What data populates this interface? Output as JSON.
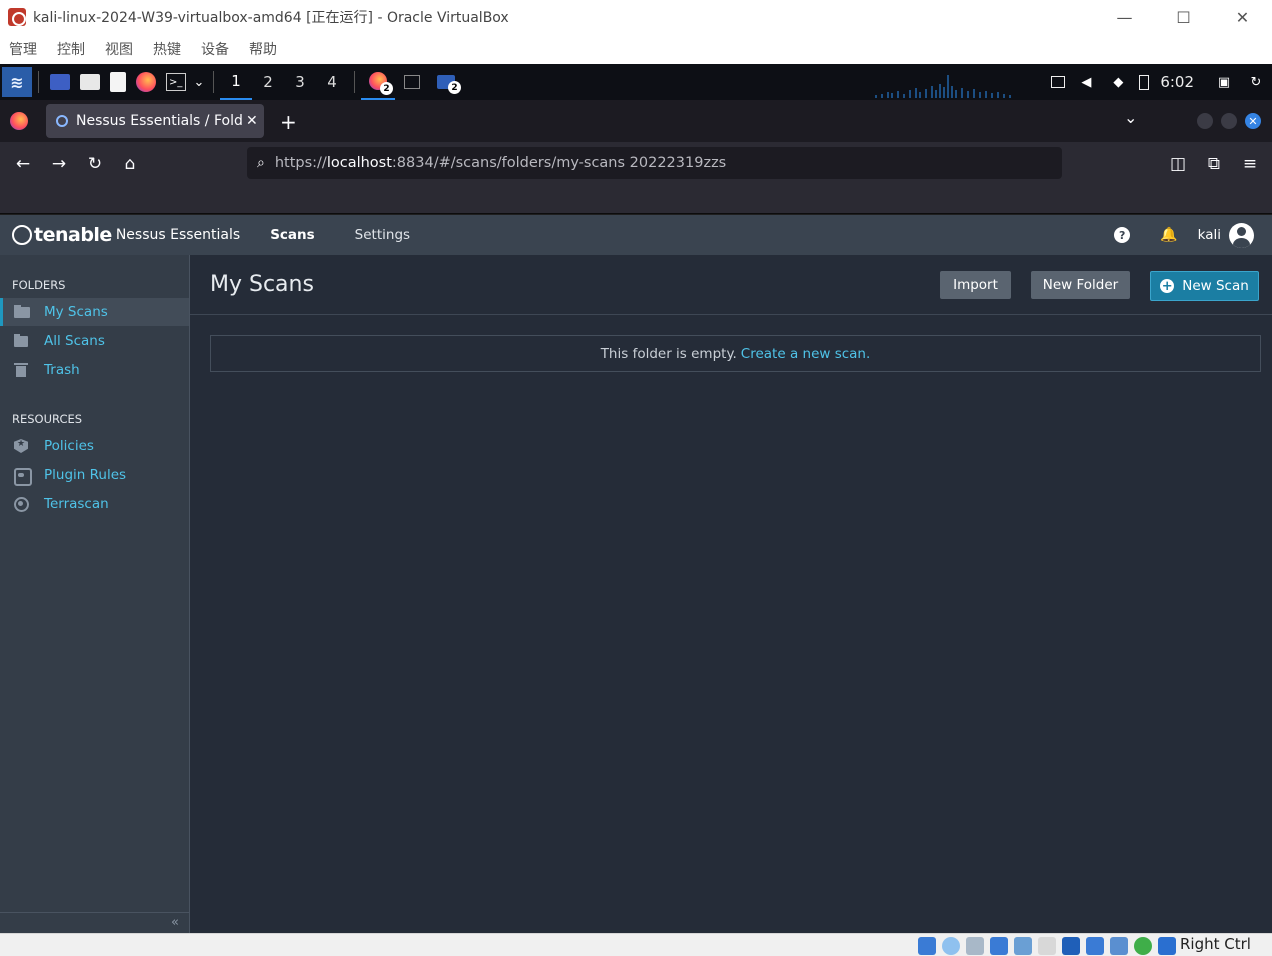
{
  "vbox": {
    "title": "kali-linux-2024-W39-virtualbox-amd64 [正在运行] - Oracle VirtualBox",
    "menu": [
      "管理",
      "控制",
      "视图",
      "热键",
      "设备",
      "帮助"
    ],
    "minimize": "—",
    "maximize": "☐",
    "close": "✕",
    "host_key": "Right Ctrl"
  },
  "kali_panel": {
    "workspaces": [
      "1",
      "2",
      "3",
      "4"
    ],
    "active_workspace": "1",
    "firefox_badge": "2",
    "files_badge": "2",
    "clock": "6:02",
    "terminal_glyph": ">_",
    "dropdown_glyph": "⌄"
  },
  "firefox": {
    "tab_title": "Nessus Essentials / Folders / View",
    "tab_close": "✕",
    "new_tab": "+",
    "list_tabs": "⌄",
    "close_window": "✕",
    "url_prefix": "https://",
    "url_host": "localhost",
    "url_rest": ":8834/#/scans/folders/my-scans 20222319zzs",
    "nav": {
      "back": "←",
      "forward": "→",
      "reload": "↻",
      "home": "⌂",
      "search_glyph": "⌕",
      "pocket": "◫",
      "extensions": "⧉",
      "menu": "≡"
    }
  },
  "nessus": {
    "brand": "tenable",
    "product": "Nessus Essentials",
    "nav": {
      "scans": "Scans",
      "settings": "Settings"
    },
    "help_glyph": "?",
    "bell_glyph": "🔔",
    "user": "kali",
    "sidebar": {
      "folders_title": "FOLDERS",
      "folders": [
        {
          "label": "My Scans",
          "icon": "folder-open-icon"
        },
        {
          "label": "All Scans",
          "icon": "folder-icon"
        },
        {
          "label": "Trash",
          "icon": "trash-icon"
        }
      ],
      "resources_title": "RESOURCES",
      "resources": [
        {
          "label": "Policies",
          "icon": "policy-icon"
        },
        {
          "label": "Plugin Rules",
          "icon": "plugin-rules-icon"
        },
        {
          "label": "Terrascan",
          "icon": "terrascan-icon"
        }
      ],
      "collapse": "«"
    },
    "main": {
      "title": "My Scans",
      "import": "Import",
      "new_folder": "New Folder",
      "new_scan": "New Scan",
      "plus_glyph": "+",
      "empty_text": "This folder is empty.",
      "empty_link": "Create a new scan",
      "empty_period": "."
    }
  },
  "colors": {
    "nessus_header": "#3a4450",
    "nessus_sidebar": "#343d48",
    "nessus_main": "#252c38",
    "link": "#4fc3e8",
    "primary_button": "#1b7ea3"
  }
}
